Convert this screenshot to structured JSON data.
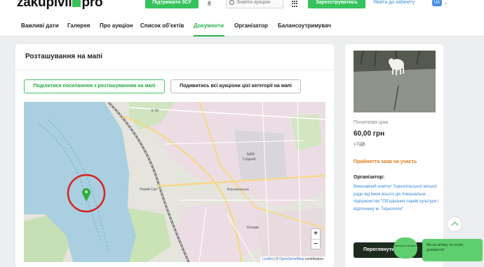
{
  "header": {
    "logo_part1": "zakupivli",
    "logo_part2": "pro",
    "support_button": "Підтримати ЗСУ",
    "lang_icon": "₴",
    "search_placeholder": "Знайти аукціон",
    "register_button": "Зареєструватись",
    "cabinet_link": "Увійти до кабінету",
    "language": "UA",
    "caret": "⌄"
  },
  "tabs": {
    "items": [
      {
        "label": "Важливі дати"
      },
      {
        "label": "Галерея"
      },
      {
        "label": "Про аукціон"
      },
      {
        "label": "Список об'єктів"
      },
      {
        "label": "Документи"
      },
      {
        "label": "Організатор"
      },
      {
        "label": "Балансоутримувач"
      }
    ],
    "active_index": 4
  },
  "map_section": {
    "title": "Розташування на мапі",
    "share_button": "Поділитися посиланням з розташуванням на мапі",
    "all_auctions_button": "Подивитись всі аукціони цієї категорії на мапі",
    "labels": {
      "road_e50": "Е 50",
      "district_new_world": "Новий Світ",
      "district_bam": "БАМ",
      "district_bam_sub": "Східний",
      "district_kanada": "Канада",
      "district_bam_industrial": "Бережанська"
    },
    "zoom_in": "+",
    "zoom_out": "−",
    "attribution_leaflet": "Leaflet",
    "attribution_separator": " | © ",
    "attribution_osm": "OpenStreetMap",
    "attribution_suffix": " contributors"
  },
  "lot": {
    "price_label": "Початкова ціна",
    "price_value": "60,00 грн",
    "vat": "з ПДВ",
    "bids_status": "Прийняття заяв на участь",
    "organizer_label": "Організатор:",
    "organizer_name": "Виконавчий комітет Тернопільської міської ради від імені всього діє Комунальне підприємство \"Об'єднання парків культури і відпочинку м. Тернополя\"",
    "view_button": "Переглянути"
  },
  "chat": {
    "small_bubble": "Залишіть питання",
    "big_bubble": "Ми на зв'язку та готові допомогти!"
  },
  "colors": {
    "accent_green": "#36c25c",
    "active_tab": "#2fb14e",
    "status_orange": "#e07a1f",
    "link_blue": "#3a8ad8",
    "water": "#a9cfe0",
    "marker_ring": "#d92020"
  },
  "icons": {
    "search": "search-icon",
    "apps": "grid-icon",
    "map_marker": "map-pin-icon",
    "scroll_top": "chevron-up-icon"
  }
}
